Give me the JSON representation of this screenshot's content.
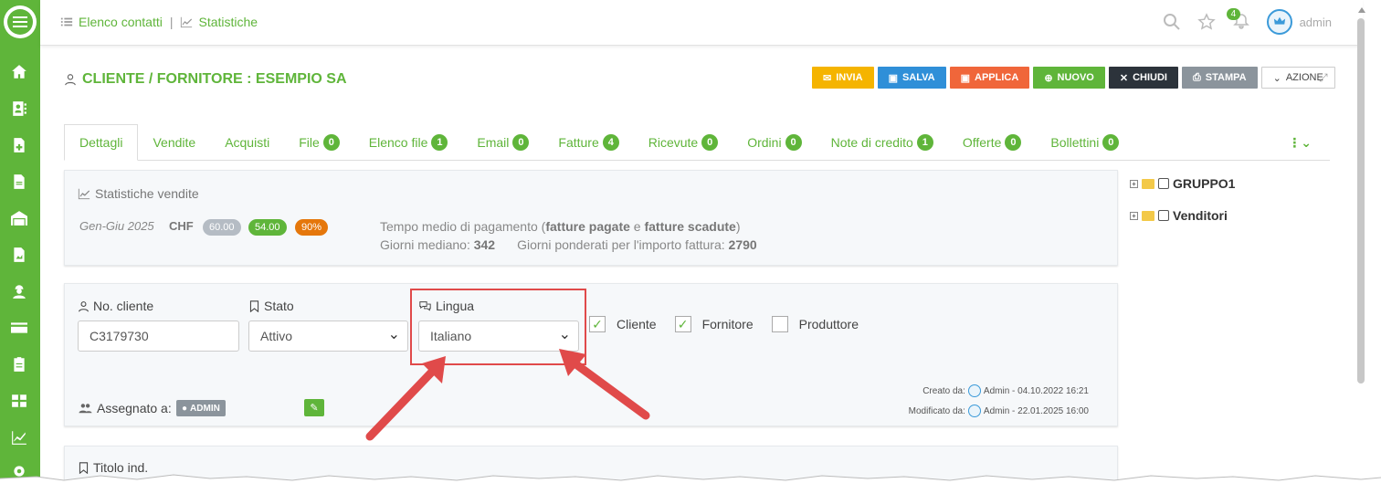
{
  "topbar": {
    "crumb_contacts": "Elenco contatti",
    "crumb_separator": "|",
    "crumb_stats": "Statistiche",
    "notifications_count": "4",
    "user_name": "admin"
  },
  "header": {
    "title": "CLIENTE / FORNITORE : ESEMPIO SA",
    "buttons": {
      "invia": "INVIA",
      "salva": "SALVA",
      "applica": "APPLICA",
      "nuovo": "NUOVO",
      "chiudi": "CHIUDI",
      "stampa": "STAMPA",
      "azione": "AZIONE"
    }
  },
  "tabs": [
    {
      "label": "Dettagli"
    },
    {
      "label": "Vendite"
    },
    {
      "label": "Acquisti"
    },
    {
      "label": "File",
      "count": "0"
    },
    {
      "label": "Elenco file",
      "count": "1"
    },
    {
      "label": "Email",
      "count": "0"
    },
    {
      "label": "Fatture",
      "count": "4"
    },
    {
      "label": "Ricevute",
      "count": "0"
    },
    {
      "label": "Ordini",
      "count": "0"
    },
    {
      "label": "Note di credito",
      "count": "1"
    },
    {
      "label": "Offerte",
      "count": "0"
    },
    {
      "label": "Bollettini",
      "count": "0"
    }
  ],
  "stats": {
    "title": "Statistiche vendite",
    "period": "Gen-Giu 2025",
    "currency": "CHF",
    "pill1": "60.00",
    "pill2": "54.00",
    "pill3": "90%",
    "tempo_prefix": "Tempo medio di pagamento (",
    "fatture_pagate": "fatture pagate",
    "tempo_e": " e ",
    "fatture_scadute": "fatture scadute",
    "tempo_suffix": ")",
    "giorni_mediano_label": "Giorni mediano:",
    "giorni_mediano": "342",
    "giorni_ponderati_label": "Giorni ponderati per l'importo fattura:",
    "giorni_ponderati": "2790"
  },
  "form": {
    "no_cliente_label": "No. cliente",
    "no_cliente_value": "C3179730",
    "stato_label": "Stato",
    "stato_value": "Attivo",
    "lingua_label": "Lingua",
    "lingua_value": "Italiano",
    "cliente_label": "Cliente",
    "fornitore_label": "Fornitore",
    "produttore_label": "Produttore",
    "assegnato_label": "Assegnato a:",
    "assegnato_value": "ADMIN",
    "creato_label": "Creato da:",
    "creato_value": "Admin - 04.10.2022 16:21",
    "modificato_label": "Modificato da:",
    "modificato_value": "Admin - 22.01.2025 16:00",
    "titolo_label": "Titolo ind."
  },
  "tree": [
    {
      "label": "GRUPPO1"
    },
    {
      "label": "Venditori"
    }
  ],
  "colors": {
    "brand": "#5fb53a",
    "highlight": "#e04a4a"
  }
}
